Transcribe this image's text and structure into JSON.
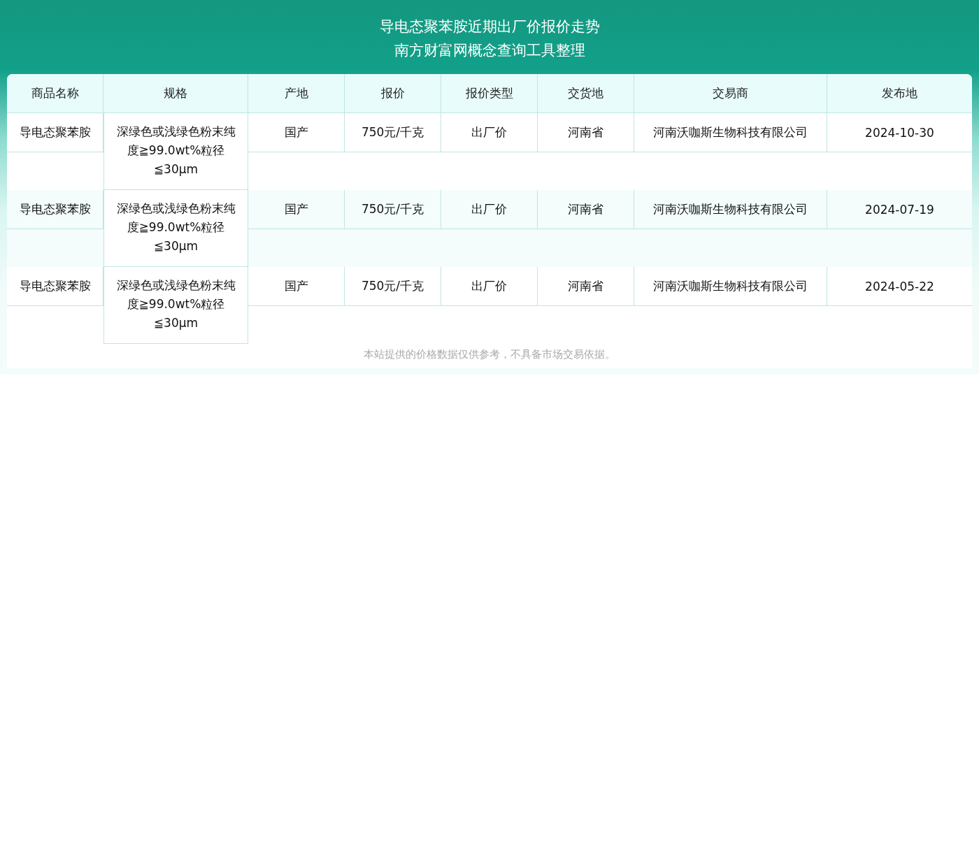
{
  "header": {
    "title_lines": [
      "导电态聚苯胺近期出厂价报价走势",
      "南方财富网概念查询工具整理"
    ]
  },
  "table": {
    "columns": [
      "商品名称",
      "规格",
      "产地",
      "报价",
      "报价类型",
      "交货地",
      "交易商",
      "发布地"
    ],
    "rows": [
      {
        "cells": [
          "导电态聚苯胺",
          "深绿色或浅绿色粉末纯度≧99.0wt%粒径≦30μm",
          "国产",
          "750元/千克",
          "出厂价",
          "河南省",
          "河南沃咖斯生物科技有限公司",
          "2024-10-30"
        ]
      },
      {
        "cells": [
          "导电态聚苯胺",
          "深绿色或浅绿色粉末纯度≧99.0wt%粒径≦30μm",
          "国产",
          "750元/千克",
          "出厂价",
          "河南省",
          "河南沃咖斯生物科技有限公司",
          "2024-07-19"
        ]
      },
      {
        "cells": [
          "导电态聚苯胺",
          "深绿色或浅绿色粉末纯度≧99.0wt%粒径≦30μm",
          "国产",
          "750元/千克",
          "出厂价",
          "河南省",
          "河南沃咖斯生物科技有限公司",
          "2024-05-22"
        ]
      }
    ]
  },
  "footer_note": "本站提供的价格数据仅供参考，不具备市场交易依据。"
}
